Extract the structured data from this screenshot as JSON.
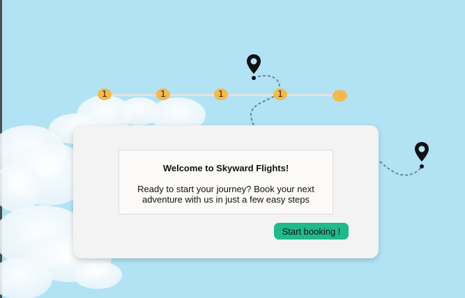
{
  "progress": {
    "steps": [
      {
        "label": "1"
      },
      {
        "label": "1"
      },
      {
        "label": "1"
      },
      {
        "label": "1"
      },
      {
        "label": ""
      }
    ]
  },
  "dialog": {
    "title": "Welcome to Skyward Flights!",
    "body": "Ready to start your journey? Book your next adventure with us in just a few easy steps",
    "button_label": "Start booking !"
  },
  "colors": {
    "sky": "#b2e3f5",
    "step": "#f5b94a",
    "cta": "#1fb98a",
    "dialog": "#f3f3f3"
  },
  "icons": [
    "location-pin-icon",
    "location-pin-icon"
  ]
}
